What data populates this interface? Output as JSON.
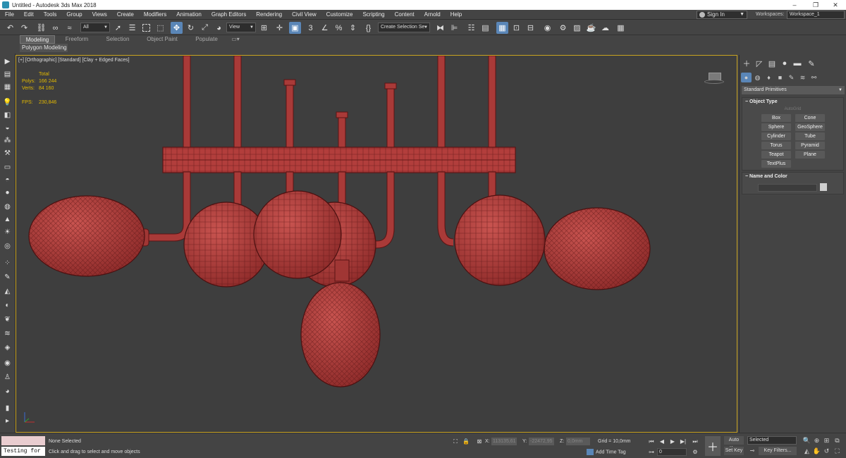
{
  "window": {
    "title": "Untitled - Autodesk 3ds Max 2018",
    "controls": [
      "–",
      "❐",
      "✕"
    ]
  },
  "menu": {
    "items": [
      "File",
      "Edit",
      "Tools",
      "Group",
      "Views",
      "Create",
      "Modifiers",
      "Animation",
      "Graph Editors",
      "Rendering",
      "Civil View",
      "Customize",
      "Scripting",
      "Content",
      "Arnold",
      "Help"
    ],
    "sign_in": "Sign In",
    "workspaces_label": "Workspaces:",
    "workspace_value": "Workspace_1"
  },
  "toolbar": {
    "selection_filter": "All",
    "ref_coord": "View",
    "named_selection": "Create Selection Se"
  },
  "ribbon": {
    "tabs": [
      "Modeling",
      "Freeform",
      "Selection",
      "Object Paint",
      "Populate"
    ],
    "active_tab": "Modeling",
    "sub_label": "Polygon Modeling"
  },
  "viewport": {
    "label": "[+] [Orthographic] [Standard] [Clay + Edged Faces]",
    "stats": {
      "total_label": "Total",
      "polys_label": "Polys:",
      "polys_value": "166 244",
      "verts_label": "Verts:",
      "verts_value": "84 160",
      "fps_label": "FPS:",
      "fps_value": "230,846"
    },
    "mesh_color": "#b8403f",
    "wire_color": "#5a1414"
  },
  "command_panel": {
    "category": "Standard Primitives",
    "object_type": {
      "title": "Object Type",
      "autogrid": "AutoGrid",
      "buttons": [
        "Box",
        "Cone",
        "Sphere",
        "GeoSphere",
        "Cylinder",
        "Tube",
        "Torus",
        "Pyramid",
        "Teapot",
        "Plane",
        "TextPlus"
      ]
    },
    "name_and_color": {
      "title": "Name and Color"
    }
  },
  "status": {
    "listener": "Testing for :",
    "selection": "None Selected",
    "prompt": "Click and drag to select and move objects",
    "x_label": "X:",
    "x_value": "113135,61",
    "y_label": "Y:",
    "y_value": "-22472,95",
    "z_label": "Z:",
    "z_value": "0,0mm",
    "grid": "Grid = 10,0mm",
    "add_time_tag": "Add Time Tag",
    "frame": "0",
    "auto_key": "Auto Key",
    "set_key": "Set Key",
    "key_mode": "Selected",
    "key_filters": "Key Filters..."
  },
  "colors": {
    "active_blue": "#5a86b7",
    "viewport_border": "#c9a321",
    "stats_yellow": "#e3b900"
  }
}
